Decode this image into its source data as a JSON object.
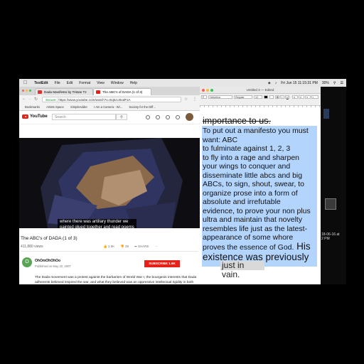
{
  "menubar": {
    "app": "TextEdit",
    "items": [
      "File",
      "Edit",
      "Format",
      "View",
      "Window",
      "Help"
    ],
    "clock": "Fri Jun 15  11:15:31 PM",
    "battery": "30%"
  },
  "browser": {
    "tabs": [
      {
        "label": "Dada Manifesto by Tristan Tz"
      },
      {
        "label": "The ABC's of DADA (1 of 3)"
      }
    ],
    "url_secure": "Secure",
    "url": "https://www.youtube.com/watch?v=EqkcU0odFxA",
    "bookmarks": [
      "Bookmarks",
      "Artists Space",
      "SimpleAdder",
      "I Am a Camera - Wi...",
      "Society for the Diff..."
    ],
    "youtube": {
      "logo_text": "YouTube",
      "search_placeholder": "Search",
      "subtitle": "where there was artillary thunder we\npainted glued together and read poems",
      "video_title": "The ABC's of DADA (1 of 3)",
      "views": "411,880 views",
      "likes": "1.6K",
      "dislikes": "39",
      "share": "SHARE",
      "channel_initial": "O",
      "channel_name": "OhOmOhOhOo",
      "published": "Published on May 22, 2007",
      "subscribe": "SUBSCRIBE 1.6K",
      "description": "The Dada movement was a protest against the barbarism of World War I, the bourgeois interests that Dada adherents believed inspired the war, and what they believed was an oppressive intellectual rigidity in both art and everyday society. Dada was an international"
    }
  },
  "textedit": {
    "title": "Untitled 3 — Edited",
    "font": "Helvetica",
    "style": "Regular",
    "size": "12",
    "strike_line": "importance to us.",
    "body_lines": [
      "To put out a manifesto you must",
      "want: ABC",
      "to fulminate against 1, 2, 3",
      "to fly into a rage and sharpen",
      "your wings to conquer and",
      "disseminate little abcs and big",
      "ABCs, to sign, shout, swear, to",
      "organize prose into a form of",
      "absolute and irrefutable",
      "evidence, to prove your non plus",
      "ultra and maintain that novelty",
      "resembles life just as the latest-",
      "appearance of some whore",
      "proves the essence of God."
    ],
    "continuation_tail": " His",
    "continuation_next": "existence was previously"
  },
  "desktop": {
    "stamp_lines": [
      "18-06-16 at",
      "2 PM"
    ],
    "behind_text": "just in vain."
  }
}
